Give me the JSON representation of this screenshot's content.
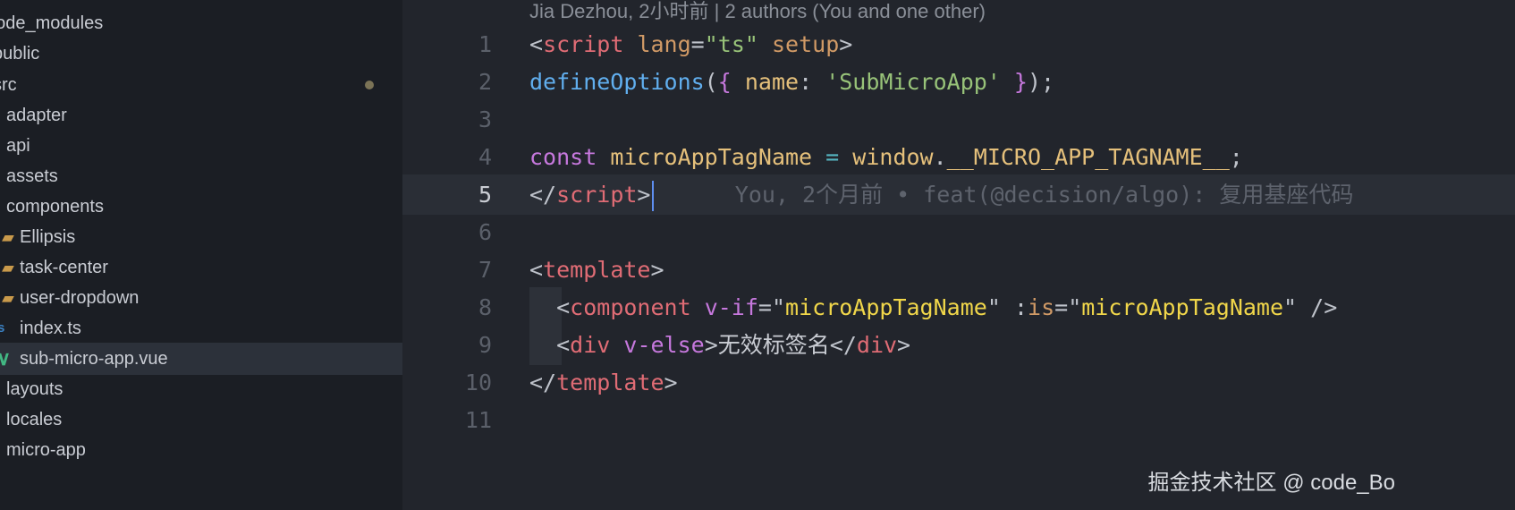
{
  "sidebar": {
    "items": [
      {
        "label": "node_modules",
        "display": "node_modules",
        "icon": "",
        "selected": false
      },
      {
        "label": "public",
        "display": "public",
        "icon": "",
        "selected": false
      },
      {
        "label": "src",
        "display": "src",
        "icon": "",
        "selected": false,
        "modified": true
      },
      {
        "label": "adapter",
        "display": "adapter",
        "icon": "",
        "selected": false
      },
      {
        "label": "api",
        "display": "api",
        "icon": "",
        "selected": false
      },
      {
        "label": "assets",
        "display": "assets",
        "icon": "",
        "selected": false
      },
      {
        "label": "components",
        "display": "components",
        "icon": "",
        "selected": false
      },
      {
        "label": "Ellipsis",
        "display": "Ellipsis",
        "icon": "folder-icon",
        "selected": false
      },
      {
        "label": "task-center",
        "display": "task-center",
        "icon": "folder-icon",
        "selected": false
      },
      {
        "label": "user-dropdown",
        "display": "user-dropdown",
        "icon": "folder-icon",
        "selected": false
      },
      {
        "label": "index.ts",
        "display": "index.ts",
        "icon": "typescript-icon",
        "selected": false
      },
      {
        "label": "sub-micro-app.vue",
        "display": "sub-micro-app.vue",
        "icon": "vue-icon",
        "selected": true
      },
      {
        "label": "layouts",
        "display": "layouts",
        "icon": "",
        "selected": false
      },
      {
        "label": "locales",
        "display": "locales",
        "icon": "",
        "selected": false
      },
      {
        "label": "micro-app",
        "display": "micro-app",
        "icon": "",
        "selected": false
      }
    ]
  },
  "editor": {
    "blame_header": "Jia Dezhou, 2小时前 | 2 authors (You and one other)",
    "current_line": 5,
    "inline_blame": "You, 2个月前 • feat(@decision/algo): 复用基座代码",
    "lines": [
      {
        "num": "1",
        "tokens": [
          [
            "<",
            "t-punc"
          ],
          [
            "script",
            "t-tag"
          ],
          [
            " ",
            "t-plain"
          ],
          [
            "lang",
            "t-attr"
          ],
          [
            "=",
            "t-punc"
          ],
          [
            "\"ts\"",
            "t-str"
          ],
          [
            " ",
            "t-plain"
          ],
          [
            "setup",
            "t-attr"
          ],
          [
            ">",
            "t-punc"
          ]
        ]
      },
      {
        "num": "2",
        "tokens": [
          [
            "defineOptions",
            "t-func"
          ],
          [
            "(",
            "t-punc"
          ],
          [
            "{",
            "t-brace"
          ],
          [
            " ",
            "t-plain"
          ],
          [
            "name",
            "t-prop"
          ],
          [
            ": ",
            "t-punc"
          ],
          [
            "'SubMicroApp'",
            "t-str"
          ],
          [
            " ",
            "t-plain"
          ],
          [
            "}",
            "t-brace"
          ],
          [
            ");",
            "t-punc"
          ]
        ]
      },
      {
        "num": "3",
        "tokens": []
      },
      {
        "num": "4",
        "tokens": [
          [
            "const",
            "t-kw"
          ],
          [
            " ",
            "t-plain"
          ],
          [
            "microAppTagName",
            "t-var"
          ],
          [
            " ",
            "t-plain"
          ],
          [
            "=",
            "t-op"
          ],
          [
            " ",
            "t-plain"
          ],
          [
            "window",
            "t-var"
          ],
          [
            ".",
            "t-punc"
          ],
          [
            "__MICRO_APP_TAGNAME__",
            "t-var"
          ],
          [
            ";",
            "t-punc"
          ]
        ]
      },
      {
        "num": "5",
        "tokens": [
          [
            "</",
            "t-punc"
          ],
          [
            "script",
            "t-tag"
          ],
          [
            ">",
            "t-punc"
          ]
        ]
      },
      {
        "num": "6",
        "tokens": []
      },
      {
        "num": "7",
        "tokens": [
          [
            "<",
            "t-punc"
          ],
          [
            "template",
            "t-tag"
          ],
          [
            ">",
            "t-punc"
          ]
        ]
      },
      {
        "num": "8",
        "tokens": [
          [
            "  ",
            "t-plain"
          ],
          [
            "<",
            "t-punc"
          ],
          [
            "component",
            "t-tag"
          ],
          [
            " ",
            "t-plain"
          ],
          [
            "v-if",
            "t-brace"
          ],
          [
            "=",
            "t-punc"
          ],
          [
            "\"",
            "t-punc"
          ],
          [
            "microAppTagName",
            "t-val"
          ],
          [
            "\"",
            "t-punc"
          ],
          [
            " ",
            "t-plain"
          ],
          [
            ":",
            "t-punc"
          ],
          [
            "is",
            "t-attr"
          ],
          [
            "=",
            "t-punc"
          ],
          [
            "\"",
            "t-punc"
          ],
          [
            "microAppTagName",
            "t-val"
          ],
          [
            "\"",
            "t-punc"
          ],
          [
            " />",
            "t-punc"
          ]
        ]
      },
      {
        "num": "9",
        "tokens": [
          [
            "  ",
            "t-plain"
          ],
          [
            "<",
            "t-punc"
          ],
          [
            "div",
            "t-tag"
          ],
          [
            " ",
            "t-plain"
          ],
          [
            "v-else",
            "t-brace"
          ],
          [
            ">",
            "t-punc"
          ],
          [
            "无效标签名",
            "t-plain"
          ],
          [
            "</",
            "t-punc"
          ],
          [
            "div",
            "t-tag"
          ],
          [
            ">",
            "t-punc"
          ]
        ]
      },
      {
        "num": "10",
        "tokens": [
          [
            "</",
            "t-punc"
          ],
          [
            "template",
            "t-tag"
          ],
          [
            ">",
            "t-punc"
          ]
        ]
      },
      {
        "num": "11",
        "tokens": []
      }
    ]
  },
  "watermark": "掘金技术社区 @ code_Bo",
  "colors": {
    "background": "#22252c",
    "sidebar_bg": "#1b1e24",
    "selected_bg": "#2c313a",
    "cursor": "#5e8ef0",
    "folder_icon": "#c99a4b",
    "vue_icon": "#42b883",
    "ts_icon": "#3b82c4"
  }
}
